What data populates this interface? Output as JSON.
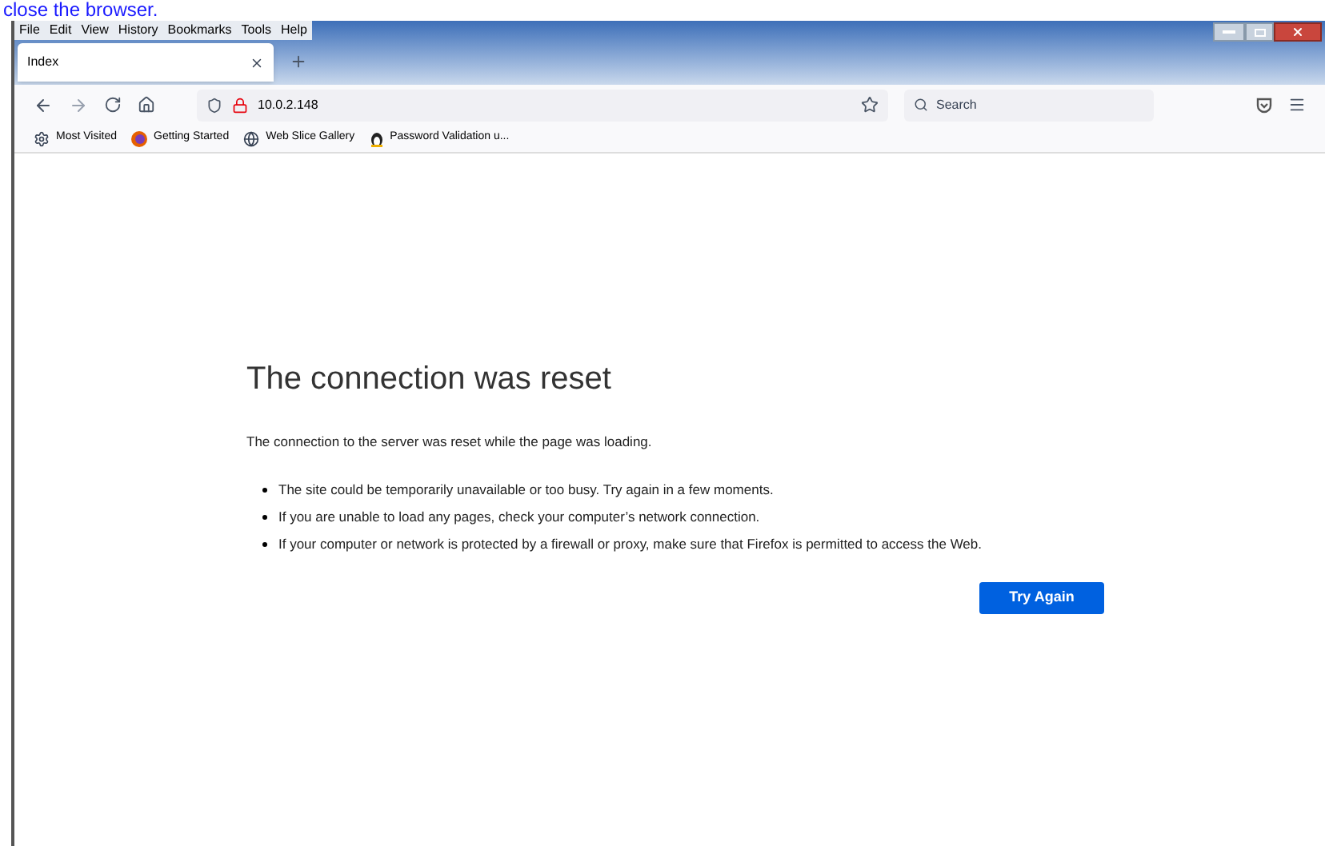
{
  "caption": "close the browser.",
  "menu": [
    "File",
    "Edit",
    "View",
    "History",
    "Bookmarks",
    "Tools",
    "Help"
  ],
  "tabs": [
    {
      "label": "Index",
      "selected": true
    }
  ],
  "address": {
    "value": "10.0.2.148"
  },
  "search": {
    "placeholder": "Search"
  },
  "bookmarks": [
    {
      "label": "Most Visited",
      "kind": "gear"
    },
    {
      "label": "Getting Started",
      "kind": "firefox"
    },
    {
      "label": "Web Slice Gallery",
      "kind": "globe"
    },
    {
      "label": "Password Validation u...",
      "kind": "linux"
    }
  ],
  "error": {
    "title": "The connection was reset",
    "message": "The connection to the server was reset while the page was loading.",
    "bullets": [
      "The site could be temporarily unavailable or too busy. Try again in a few moments.",
      "If you are unable to load any pages, check your computer’s network connection.",
      "If your computer or network is protected by a firewall or proxy, make sure that Firefox is permitted to access the Web."
    ],
    "button": "Try Again"
  }
}
